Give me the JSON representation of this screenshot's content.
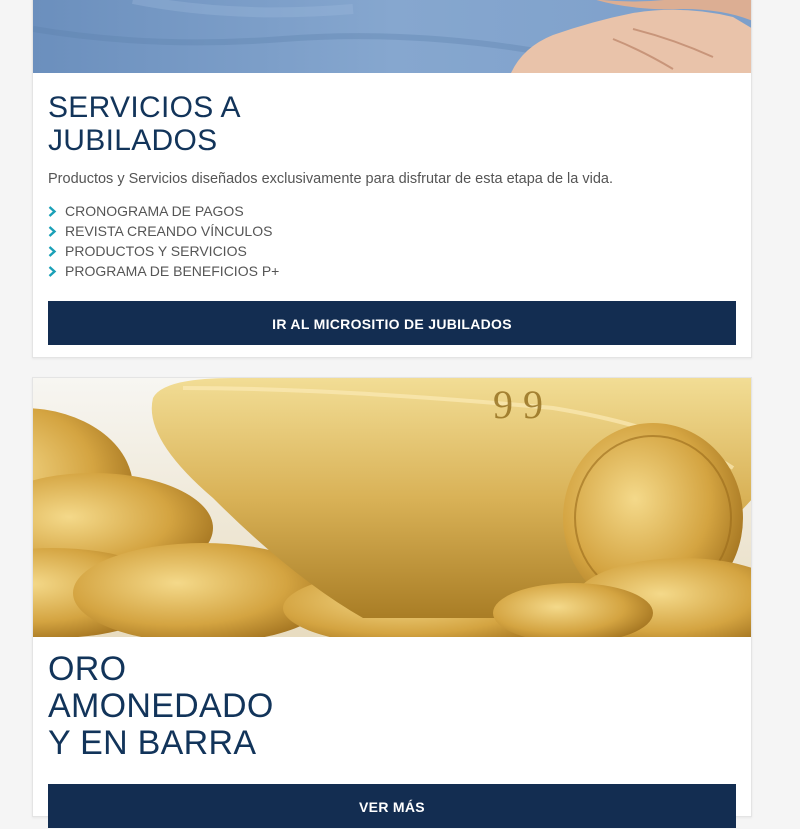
{
  "colors": {
    "title": "#12345a",
    "button_bg": "#132d51",
    "chevron": "#1aa0b7"
  },
  "jubilados": {
    "title_line1": "SERVICIOS A",
    "title_line2": "JUBILADOS",
    "description": "Productos y Servicios diseñados exclusivamente para disfrutar de esta etapa de la vida.",
    "links": [
      {
        "label": "CRONOGRAMA DE PAGOS",
        "icon": "chevron-right-icon"
      },
      {
        "label": "REVISTA CREANDO VÍNCULOS",
        "icon": "chevron-right-icon"
      },
      {
        "label": "PRODUCTOS Y SERVICIOS",
        "icon": "chevron-right-icon"
      },
      {
        "label": "PROGRAMA DE BENEFICIOS P+",
        "icon": "chevron-right-icon"
      }
    ],
    "button_label": "IR AL MICROSITIO DE JUBILADOS"
  },
  "oro": {
    "title_line1": "ORO",
    "title_line2": "AMONEDADO",
    "title_line3": "Y EN BARRA",
    "button_label": "VER MÁS"
  }
}
